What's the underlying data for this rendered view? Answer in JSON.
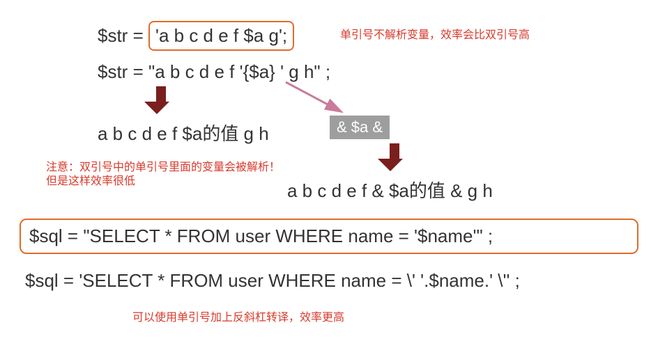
{
  "line1_prefix": "$str = ",
  "line1_box": "'a b c d e f $a g';",
  "note1": "单引号不解析变量，效率会比双引号高",
  "line2": "$str =   \"a b c d e f  '{$a} '  g h\"  ;",
  "line3": "a b c d e f  $a的值 g h",
  "gray": "& $a &",
  "note2a": "注意：双引号中的单引号里面的变量会被解析！",
  "note2b": "但是这样效率很低",
  "line4": "a b c d e f  &  $a的值 & g h",
  "sql1": "$sql =   \"SELECT  * FROM user   WHERE name = '$name'\"   ;",
  "sql2": "$sql = 'SELECT  * FROM user   WHERE name = \\' '.$name.' \\''  ;",
  "note3": "可以使用单引号加上反斜杠转译，效率更高"
}
